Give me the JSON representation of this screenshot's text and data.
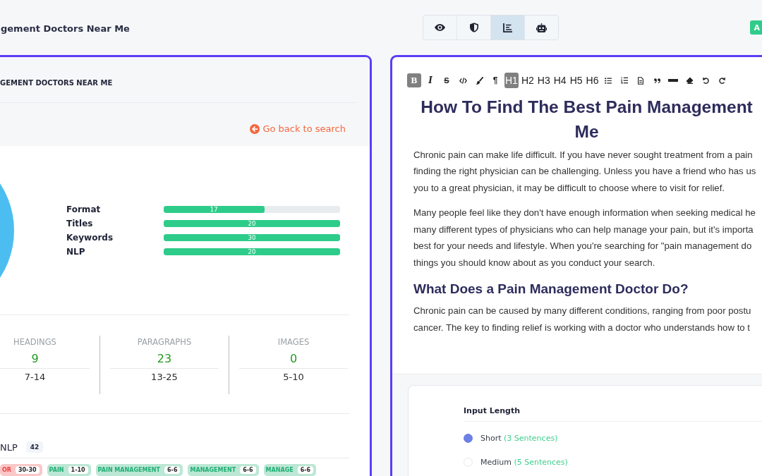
{
  "page": {
    "title": "gement Doctors Near Me",
    "badge": "A"
  },
  "view_buttons": [
    {
      "kind": "eye",
      "selected": false
    },
    {
      "kind": "shield",
      "selected": false
    },
    {
      "kind": "chart",
      "selected": true
    },
    {
      "kind": "robot",
      "selected": false
    }
  ],
  "report_panel": {
    "title": "GEMENT DOCTORS NEAR ME",
    "back_link": "Go back to search",
    "scores": [
      {
        "name": "Format",
        "value": "17",
        "level": 0.57
      },
      {
        "name": "Titles",
        "value": "20",
        "level": 1
      },
      {
        "name": "Keywords",
        "value": "30",
        "level": 1
      },
      {
        "name": "NLP",
        "value": "20",
        "level": 1
      }
    ],
    "stats": [
      {
        "label": "HEADINGS",
        "value": "9",
        "range": "7-14"
      },
      {
        "label": "PARAGRAPHS",
        "value": "23",
        "range": "13-25"
      },
      {
        "label": "IMAGES",
        "value": "0",
        "range": "5-10"
      }
    ],
    "nlp": {
      "label": "NLP",
      "count": "42"
    },
    "terms": [
      {
        "term": "OR",
        "range": "30-30",
        "color": "#ef4444"
      },
      {
        "term": "PAIN",
        "range": "1-10",
        "color": "#1fae74"
      },
      {
        "term": "PAIN MANAGEMENT",
        "range": "6-6",
        "color": "#1fae74"
      },
      {
        "term": "MANAGEMENT",
        "range": "6-6",
        "color": "#1fae74"
      },
      {
        "term": "MANAGE",
        "range": "6-6",
        "color": "#1fae74"
      }
    ]
  },
  "editor": {
    "toolbar": [
      {
        "kind": "bold",
        "label": "B",
        "selected": true
      },
      {
        "kind": "italic",
        "label": "I",
        "selected": false
      },
      {
        "kind": "strike",
        "label": "S",
        "selected": false
      },
      {
        "kind": "code",
        "selected": false
      },
      {
        "kind": "brush",
        "selected": false
      },
      {
        "kind": "paragraph",
        "label": "¶",
        "selected": false
      },
      {
        "kind": "heading",
        "label": "H1",
        "selected": true
      },
      {
        "kind": "heading",
        "label": "H2",
        "selected": false
      },
      {
        "kind": "heading",
        "label": "H3",
        "selected": false
      },
      {
        "kind": "heading",
        "label": "H4",
        "selected": false
      },
      {
        "kind": "heading",
        "label": "H5",
        "selected": false
      },
      {
        "kind": "heading",
        "label": "H6",
        "selected": false
      },
      {
        "kind": "bullet-list",
        "selected": false
      },
      {
        "kind": "ordered-list",
        "selected": false
      },
      {
        "kind": "document",
        "selected": false
      },
      {
        "kind": "quote",
        "selected": false
      },
      {
        "kind": "rule",
        "selected": false
      },
      {
        "kind": "eraser",
        "selected": false
      },
      {
        "kind": "undo",
        "selected": false
      },
      {
        "kind": "redo",
        "selected": false
      }
    ],
    "blocks": [
      {
        "kind": "title",
        "lines": [
          "How To Find The Best Pain Management",
          "Me"
        ]
      },
      {
        "kind": "paragraph",
        "lines": [
          "Chronic pain can make life difficult. If you have never sought treatment from a pain",
          "finding the right physician can be challenging. Unless you have a friend who has us",
          "you to a great physician, it may be difficult to choose where to visit for relief."
        ]
      },
      {
        "kind": "paragraph",
        "lines": [
          "Many people feel like they don't have enough information when seeking medical he",
          "many different types of physicians who can help manage your pain, but it's importa",
          "best for your needs and lifestyle. When you're searching for \"pain management do",
          "things you should know about as you conduct your search."
        ]
      },
      {
        "kind": "subheading",
        "lines": [
          "What Does a Pain Management Doctor Do?"
        ]
      },
      {
        "kind": "paragraph",
        "lines": [
          "Chronic pain can be caused by many different conditions, ranging from poor postu",
          "cancer. The key to finding relief is working with a doctor who understands how to t"
        ]
      }
    ]
  },
  "input_length": {
    "title": "Input Length",
    "options": [
      {
        "label": "Short",
        "note": "(3 Sentences)",
        "selected": true
      },
      {
        "label": "Medium",
        "note": "(5 Sentences)",
        "selected": false
      }
    ]
  }
}
